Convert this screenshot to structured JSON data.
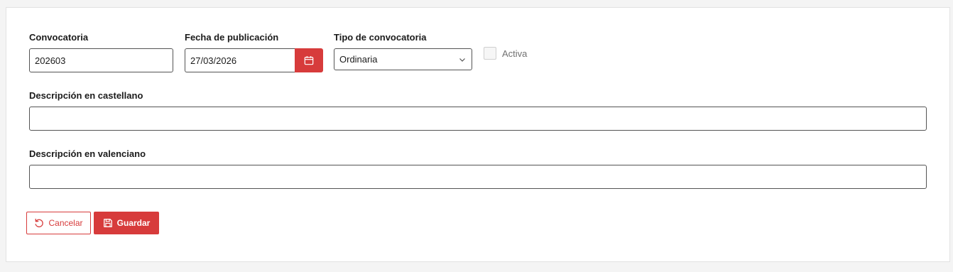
{
  "form": {
    "convocatoria": {
      "label": "Convocatoria",
      "value": "202603"
    },
    "fecha": {
      "label": "Fecha de publicación",
      "value": "27/03/2026",
      "icon": "calendar-icon"
    },
    "tipo": {
      "label": "Tipo de convocatoria",
      "selected": "Ordinaria",
      "icon": "chevron-down-icon"
    },
    "activa": {
      "label": "Activa",
      "checked": false
    },
    "desc_castellano": {
      "label": "Descripción en castellano",
      "value": ""
    },
    "desc_valenciano": {
      "label": "Descripción en valenciano",
      "value": ""
    }
  },
  "actions": {
    "cancel_label": "Cancelar",
    "cancel_icon": "undo-icon",
    "save_label": "Guardar",
    "save_icon": "save-icon"
  },
  "colors": {
    "accent": "#d73b3b",
    "border": "#545454",
    "background": "#f4f4f4"
  }
}
